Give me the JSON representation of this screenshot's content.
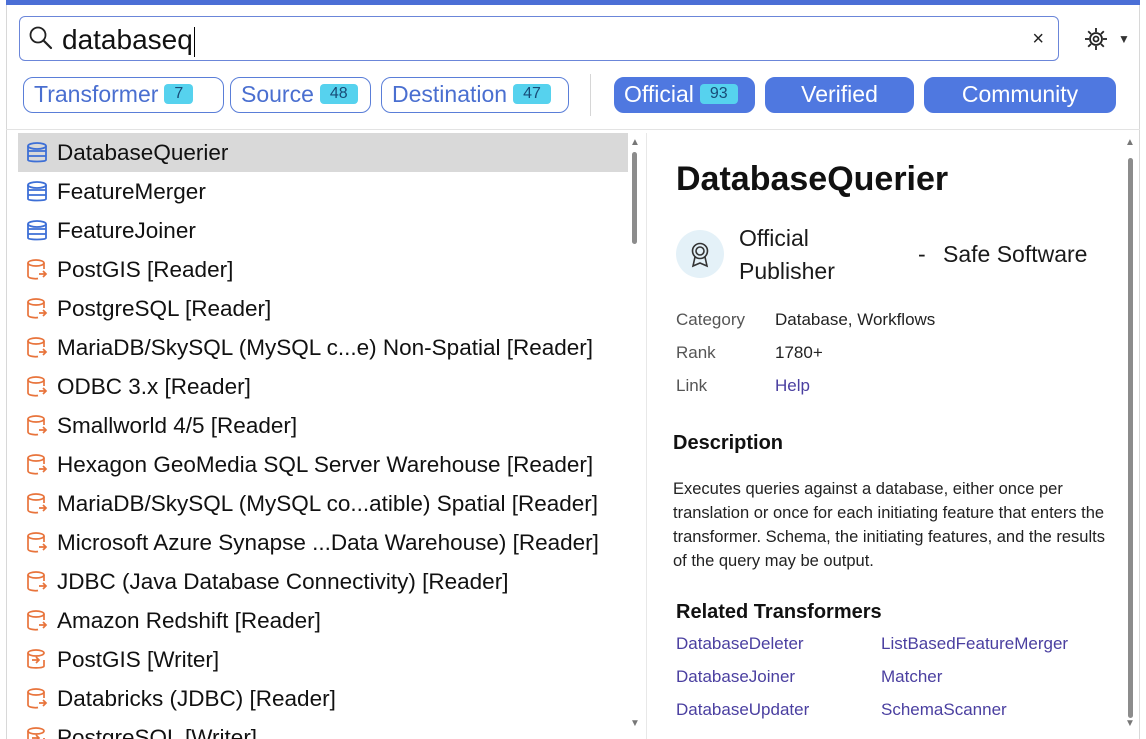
{
  "search": {
    "value": "databaseq",
    "clear_label": "×"
  },
  "filters": {
    "transformer": {
      "label": "Transformer",
      "count": "7"
    },
    "source": {
      "label": "Source",
      "count": "48"
    },
    "destination": {
      "label": "Destination",
      "count": "47"
    },
    "official": {
      "label": "Official",
      "count": "93"
    },
    "verified": {
      "label": "Verified"
    },
    "community": {
      "label": "Community"
    }
  },
  "colors": {
    "accent": "#4f78e0",
    "badge": "#56d2ee",
    "reader_icon": "#e8743c",
    "transformer_icon": "#3d6fd6"
  },
  "results": [
    {
      "label": "DatabaseQuerier",
      "icon": "transformer-icon",
      "selected": true
    },
    {
      "label": "FeatureMerger",
      "icon": "transformer-icon"
    },
    {
      "label": "FeatureJoiner",
      "icon": "transformer-icon"
    },
    {
      "label": "PostGIS [Reader]",
      "icon": "reader-icon"
    },
    {
      "label": "PostgreSQL [Reader]",
      "icon": "reader-icon"
    },
    {
      "label": "MariaDB/SkySQL (MySQL c...e) Non-Spatial [Reader]",
      "icon": "reader-icon"
    },
    {
      "label": "ODBC 3.x [Reader]",
      "icon": "reader-icon"
    },
    {
      "label": "Smallworld 4/5 [Reader]",
      "icon": "reader-icon"
    },
    {
      "label": "Hexagon GeoMedia SQL Server Warehouse [Reader]",
      "icon": "reader-icon"
    },
    {
      "label": "MariaDB/SkySQL (MySQL co...atible) Spatial [Reader]",
      "icon": "reader-icon"
    },
    {
      "label": "Microsoft Azure Synapse ...Data Warehouse) [Reader]",
      "icon": "reader-icon"
    },
    {
      "label": "JDBC (Java Database Connectivity) [Reader]",
      "icon": "reader-icon"
    },
    {
      "label": "Amazon Redshift [Reader]",
      "icon": "reader-icon"
    },
    {
      "label": "PostGIS [Writer]",
      "icon": "writer-icon"
    },
    {
      "label": "Databricks (JDBC) [Reader]",
      "icon": "reader-icon"
    },
    {
      "label": "PostgreSQL [Writer]",
      "icon": "writer-icon"
    }
  ],
  "detail": {
    "title": "DatabaseQuerier",
    "publisher_line1": "Official",
    "publisher_line2": "Publisher",
    "publisher_dash": "-",
    "publisher_name": "Safe Software",
    "category_label": "Category",
    "category_value": "Database, Workflows",
    "rank_label": "Rank",
    "rank_value": "1780+",
    "link_label": "Link",
    "link_value": "Help",
    "description_heading": "Description",
    "description": "Executes queries against a database, either once per translation or once for each initiating feature that enters the transformer. Schema, the initiating features, and the results of the query may be output.",
    "related_heading": "Related Transformers",
    "related": [
      "DatabaseDeleter",
      "ListBasedFeatureMerger",
      "DatabaseJoiner",
      "Matcher",
      "DatabaseUpdater",
      "SchemaScanner"
    ]
  }
}
